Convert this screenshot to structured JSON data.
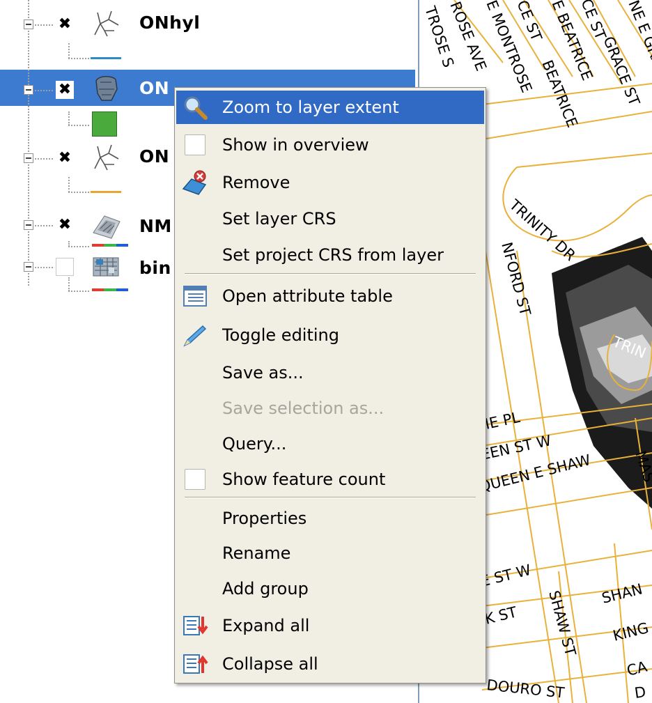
{
  "layers": [
    {
      "name": "ONhyl",
      "checked": true,
      "icon": "line-layer-icon",
      "legend": "blue-line",
      "selected": false
    },
    {
      "name": "ON",
      "checked": true,
      "icon": "polygon-layer-icon",
      "legend": "green-square",
      "selected": true
    },
    {
      "name": "ON",
      "checked": true,
      "icon": "line-layer-icon",
      "legend": "orange-line",
      "selected": false
    },
    {
      "name": "NM",
      "checked": true,
      "icon": "raster-layer-icon",
      "legend": "rgb-bands",
      "selected": false
    },
    {
      "name": "bin",
      "checked": false,
      "icon": "raster-layer-icon",
      "legend": "rgb-bands",
      "selected": false
    }
  ],
  "check_mark": "✖",
  "context_menu": {
    "items": [
      {
        "label": "Zoom to layer extent",
        "icon": "zoom-extent-icon",
        "highlighted": true
      },
      {
        "label": "Show in overview",
        "icon": "checkbox-icon"
      },
      {
        "label": "Remove",
        "icon": "remove-layer-icon"
      },
      {
        "label": "Set layer CRS",
        "icon": ""
      },
      {
        "label": "Set project CRS from layer",
        "icon": ""
      },
      {
        "label": "Open attribute table",
        "icon": "attribute-table-icon"
      },
      {
        "label": "Toggle editing",
        "icon": "pencil-icon"
      },
      {
        "label": "Save as...",
        "icon": ""
      },
      {
        "label": "Save selection as...",
        "icon": "",
        "disabled": true
      },
      {
        "label": "Query...",
        "icon": ""
      },
      {
        "label": "Show feature count",
        "icon": "checkbox-icon"
      },
      {
        "label": "Properties",
        "icon": ""
      },
      {
        "label": "Rename",
        "icon": ""
      },
      {
        "label": "Add group",
        "icon": ""
      },
      {
        "label": "Expand all",
        "icon": "expand-all-icon"
      },
      {
        "label": "Collapse all",
        "icon": "collapse-all-icon"
      }
    ]
  },
  "map_labels": [
    "TROSE S",
    "ROSE AVE",
    "E MONTROSE",
    "CE ST",
    "BEATRICE",
    "E BEATRICE",
    "CE ST",
    "GRACE ST",
    "NE E GRA",
    "TRINITY DR",
    "NFORD ST",
    "TRIN",
    "IE PL",
    "EEN ST W",
    "QUEEN E SHAW",
    "MAS",
    "E ST W",
    "SHAN",
    "K ST",
    "SHAW ST",
    "KING",
    "CA",
    "DOURO ST",
    "D"
  ],
  "colors": {
    "selection": "#3d7bd1",
    "menu_highlight": "#316ac5",
    "menu_background": "#f1efe4",
    "road": "#e9b13a",
    "legend_blue": "#2e8ac8",
    "legend_green": "#4aab3c",
    "legend_orange": "#e9a431"
  }
}
